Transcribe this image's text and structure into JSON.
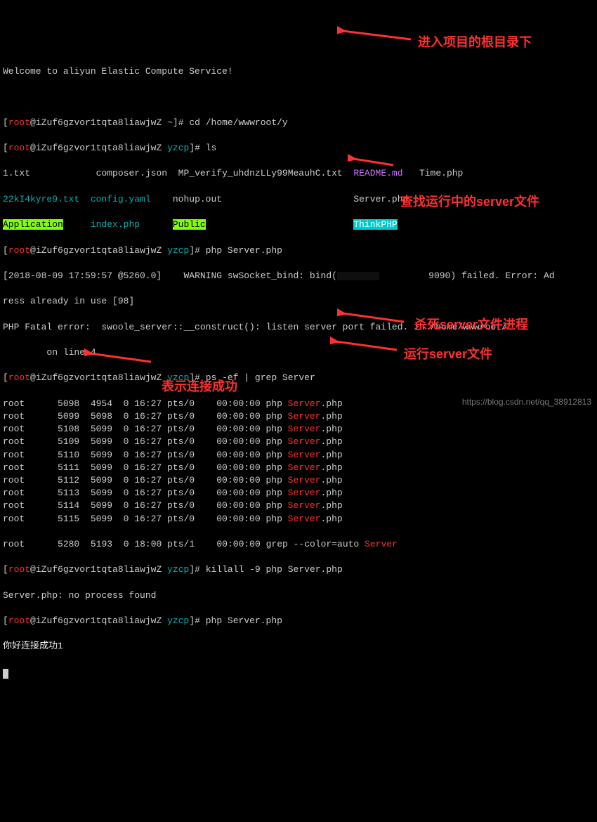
{
  "welcome": "Welcome to aliyun Elastic Compute Service!",
  "prompt": {
    "user": "root",
    "host": "iZuf6gzvor1tqta8liawjwZ",
    "dir_home": "~",
    "dir_yzcp": "yzcp"
  },
  "cmds": {
    "cd": "cd /home/wwwroot/y",
    "ls": "ls",
    "php_server": "php Server.php",
    "ps": "ps -ef | grep Server",
    "killall": "killall -9 php Server.php",
    "php_server2": "php Server.php"
  },
  "files": {
    "f1": "1.txt",
    "f2": "composer.json",
    "f3": "MP_verify_uhdnzLLy99MeauhC.txt",
    "f4": "README.md",
    "f5": "Time.php",
    "f6": "22kI4kyre9.txt",
    "f7": "config.yaml",
    "f8": "nohup.out",
    "f9": "Server.php",
    "f10": "Application",
    "f11": "index.php",
    "f12": "Public",
    "f13": "ThinkPHP"
  },
  "warning": {
    "ts": "[2018-08-09 17:59:57 @5260.0]",
    "label": "WARNING",
    "msg1": "swSocket_bind: bind(",
    "msg2": "9090) failed. Error: Ad",
    "msg3": "ress already in use [98]"
  },
  "fatal": {
    "p1": "PHP Fatal error:  swoole_server::__construct(): listen server port failed. in /home/wwwroot/",
    "p2": "on line 4"
  },
  "ps_rows": [
    {
      "user": "root",
      "pid": "5098",
      "ppid": "4954",
      "c": "0",
      "time": "16:27",
      "tty": "pts/0",
      "etime": "00:00:00",
      "cmd": "php",
      "tail": ".php"
    },
    {
      "user": "root",
      "pid": "5099",
      "ppid": "5098",
      "c": "0",
      "time": "16:27",
      "tty": "pts/0",
      "etime": "00:00:00",
      "cmd": "php",
      "tail": ".php"
    },
    {
      "user": "root",
      "pid": "5108",
      "ppid": "5099",
      "c": "0",
      "time": "16:27",
      "tty": "pts/0",
      "etime": "00:00:00",
      "cmd": "php",
      "tail": ".php"
    },
    {
      "user": "root",
      "pid": "5109",
      "ppid": "5099",
      "c": "0",
      "time": "16:27",
      "tty": "pts/0",
      "etime": "00:00:00",
      "cmd": "php",
      "tail": ".php"
    },
    {
      "user": "root",
      "pid": "5110",
      "ppid": "5099",
      "c": "0",
      "time": "16:27",
      "tty": "pts/0",
      "etime": "00:00:00",
      "cmd": "php",
      "tail": ".php"
    },
    {
      "user": "root",
      "pid": "5111",
      "ppid": "5099",
      "c": "0",
      "time": "16:27",
      "tty": "pts/0",
      "etime": "00:00:00",
      "cmd": "php",
      "tail": ".php"
    },
    {
      "user": "root",
      "pid": "5112",
      "ppid": "5099",
      "c": "0",
      "time": "16:27",
      "tty": "pts/0",
      "etime": "00:00:00",
      "cmd": "php",
      "tail": ".php"
    },
    {
      "user": "root",
      "pid": "5113",
      "ppid": "5099",
      "c": "0",
      "time": "16:27",
      "tty": "pts/0",
      "etime": "00:00:00",
      "cmd": "php",
      "tail": ".php"
    },
    {
      "user": "root",
      "pid": "5114",
      "ppid": "5099",
      "c": "0",
      "time": "16:27",
      "tty": "pts/0",
      "etime": "00:00:00",
      "cmd": "php",
      "tail": ".php"
    },
    {
      "user": "root",
      "pid": "5115",
      "ppid": "5099",
      "c": "0",
      "time": "16:27",
      "tty": "pts/0",
      "etime": "00:00:00",
      "cmd": "php",
      "tail": ".php"
    }
  ],
  "ps_server": "Server",
  "ps_grep": {
    "user": "root",
    "pid": "5280",
    "ppid": "5193",
    "c": "0",
    "time": "18:00",
    "tty": "pts/1",
    "etime": "00:00:00",
    "cmd": "grep --color=auto",
    "tail": "Server"
  },
  "kill_out": "Server.php: no process found",
  "success": "你好连接成功1",
  "annotations": {
    "a1": "进入项目的根目录下",
    "a2": "查找运行中的server文件",
    "a3": "杀死server文件进程",
    "a4": "运行server文件",
    "a5": "表示连接成功"
  },
  "credit": "https://blog.csdn.net/qq_38912813"
}
